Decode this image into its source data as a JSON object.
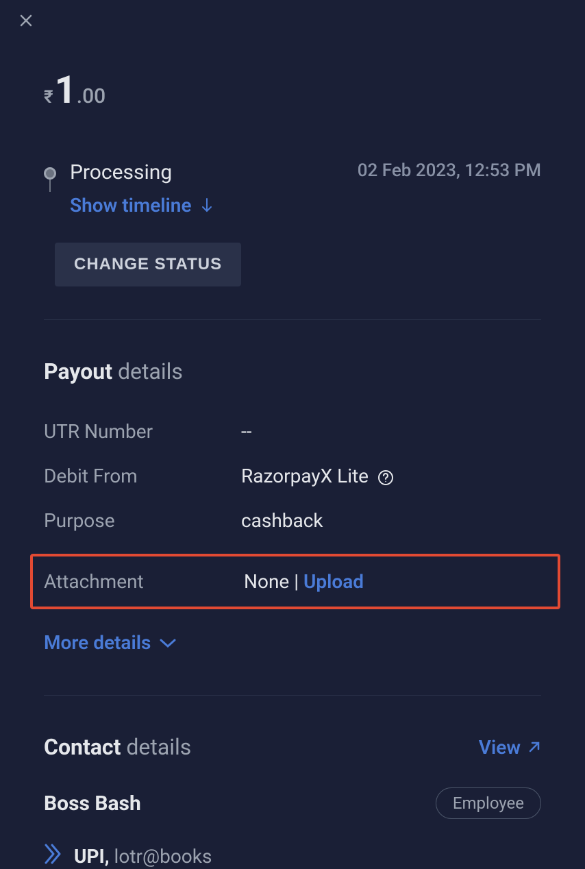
{
  "amount": {
    "currency": "₹",
    "whole": "1",
    "decimal": ".00"
  },
  "status": {
    "label": "Processing",
    "timestamp": "02 Feb 2023, 12:53 PM",
    "timeline_link": "Show timeline",
    "change_button": "CHANGE STATUS"
  },
  "payout_section": {
    "title_bold": "Payout",
    "title_light": " details",
    "rows": {
      "utr_label": "UTR Number",
      "utr_value": "--",
      "debit_label": "Debit From",
      "debit_value": "RazorpayX Lite",
      "purpose_label": "Purpose",
      "purpose_value": "cashback",
      "attachment_label": "Attachment",
      "attachment_value": "None | ",
      "attachment_upload": "Upload"
    },
    "more_details": "More details"
  },
  "contact_section": {
    "title_bold": "Contact",
    "title_light": " details",
    "view_link": "View",
    "name": "Boss Bash",
    "role_badge": "Employee",
    "method": "UPI,",
    "id": " lotr@books"
  }
}
